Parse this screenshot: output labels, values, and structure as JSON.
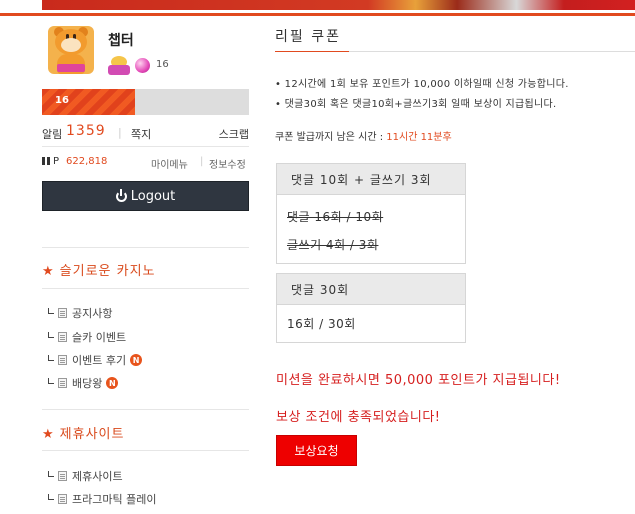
{
  "colors": {
    "accent": "#e14a1f",
    "red_text": "#d61f1f",
    "reward_button": "#ee0000",
    "logout_bg": "#2f3640"
  },
  "profile": {
    "nickname": "챕터",
    "gem_count": "16",
    "level": "16",
    "level_progress_percent": 45,
    "alarm_label": "알림",
    "alarm_count": "1359",
    "note_label": "쪽지",
    "scrap_label": "스크랩",
    "point_prefix": "P",
    "point_value": "622,818",
    "my_menu_label": "마이메뉴",
    "info_edit_label": "정보수정",
    "logout_label": "Logout"
  },
  "sidebar": {
    "section1": {
      "title": "슬기로운 카지노",
      "items": [
        {
          "label": "공지사항",
          "new": false
        },
        {
          "label": "슬카 이벤트",
          "new": false
        },
        {
          "label": "이벤트 후기",
          "new": true
        },
        {
          "label": "배당왕",
          "new": true
        }
      ]
    },
    "section2": {
      "title": "제휴사이트",
      "items": [
        {
          "label": "제휴사이트",
          "new": false
        },
        {
          "label": "프라그마틱 플레이",
          "new": false
        }
      ]
    },
    "new_badge": "N",
    "star_glyph": "★"
  },
  "main": {
    "title": "리필 쿠폰",
    "notices": [
      "• 12시간에 1회 보유 포인트가 10,000 이하일때 신청 가능합니다.",
      "• 댓글30회 혹은 댓글10회+글쓰기3회 일때 보상이 지급됩니다."
    ],
    "deadline_label": "쿠폰 발급까지 남은 시간 : ",
    "deadline_time": "11시간 11분후",
    "box1": {
      "header": "댓글 10회 + 글쓰기 3회",
      "line1": "댓글 16회 / 10회",
      "line2": "글쓰기 4회 / 3회"
    },
    "box2": {
      "header": "댓글 30회",
      "line1": "16회 / 30회"
    },
    "mission_text": "미션을 완료하시면 50,000 포인트가 지급됩니다!",
    "reward_ok_text": "보상 조건에 충족되었습니다!",
    "reward_button": "보상요청"
  }
}
